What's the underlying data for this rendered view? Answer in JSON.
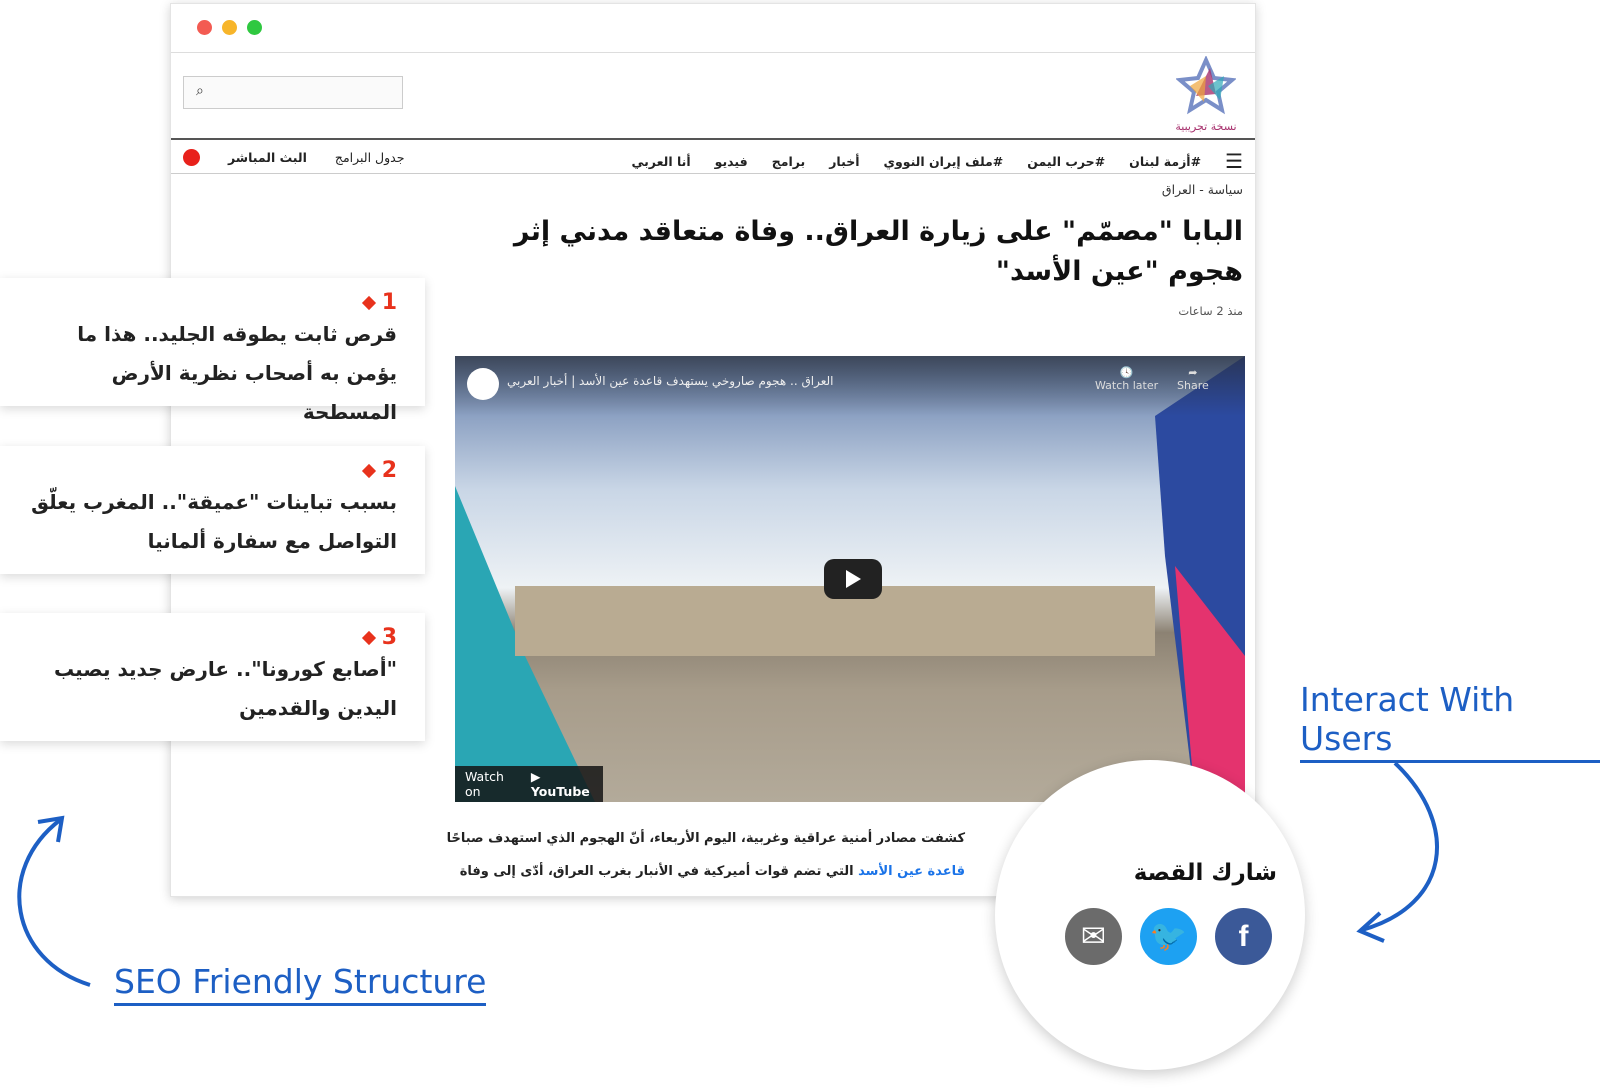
{
  "window": {
    "dot_colors": [
      "#f35b52",
      "#f7b52a",
      "#2fc840"
    ]
  },
  "search": {
    "icon": "search-icon",
    "placeholder": ""
  },
  "logo": {
    "caption": "نسخة تجريبية"
  },
  "nav": {
    "items": [
      "#أزمة لبنان",
      "#حرب اليمن",
      "#ملف إيران النووي",
      "أخبار",
      "برامج",
      "فيديو",
      "أنا العربي"
    ],
    "schedule": "جدول البرامج",
    "live": "البث المباشر"
  },
  "article": {
    "breadcrumb": "سياسة - العراق",
    "title": "البابا \"مصمّم\" على زيارة العراق.. وفاة متعاقد مدني إثر هجوم \"عين الأسد\"",
    "time": "منذ 2 ساعات",
    "body_1": "كشفت مصادر أمنية عراقية وغربية، اليوم الأربعاء، أنّ الهجوم الذي استهدف صباحًا",
    "body_link": "قاعدة عين الأسد",
    "body_2": " التي تضم قوات أميركية في الأنبار بغرب العراق، أدّى إلى وفاة"
  },
  "video": {
    "title": "العراق .. هجوم صاروخي يستهدف قاعدة عين الأسد | أخبار العربي",
    "watch_later": "Watch later",
    "share": "Share",
    "watch_on": "Watch on",
    "youtube": "YouTube"
  },
  "cards": [
    {
      "num": "1",
      "text": "قرص ثابت يطوقه الجليد.. هذا ما يؤمن به أصحاب نظرية الأرض المسطحة"
    },
    {
      "num": "2",
      "text": "بسبب تباينات \"عميقة\".. المغرب يعلّق التواصل مع سفارة ألمانيا"
    },
    {
      "num": "3",
      "text": "\"أصابع كورونا\".. عارض جديد يصيب اليدين والقدمين"
    }
  ],
  "share": {
    "title": "شارك القصة",
    "icons": [
      "email-icon",
      "twitter-icon",
      "facebook-icon"
    ]
  },
  "labels": {
    "interact": "Interact With Users",
    "seo": "SEO Friendly Structure"
  },
  "accent": "#1d5fc4"
}
